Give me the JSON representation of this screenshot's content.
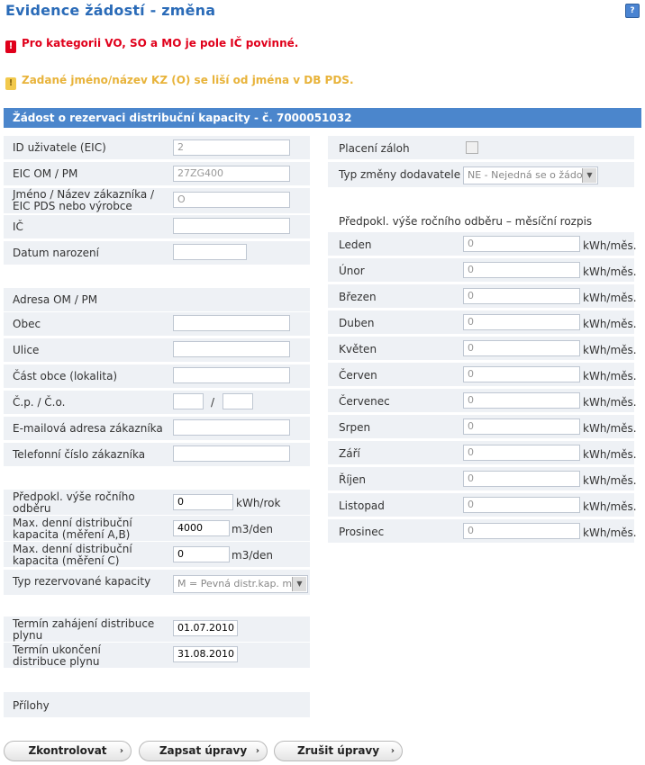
{
  "title": "Evidence žádostí - změna",
  "messages": {
    "error": "Pro kategorii VO, SO a MO je pole IČ povinné.",
    "warning": "Zadané jméno/název KZ (O) se liší od jména v DB PDS."
  },
  "section_title": "Žádost o rezervaci distribuční kapacity - č. 7000051032",
  "left": {
    "eic_label": "ID uživatele (EIC)",
    "eic_value": "2",
    "eicom_label": "EIC OM / PM",
    "eicom_value": "27ZG400",
    "name_label": "Jméno / Název zákazníka / EIC PDS nebo výrobce",
    "name_value": "O",
    "ic_label": "IČ",
    "ic_value": "",
    "birth_label": "Datum narození",
    "birth_value": "",
    "address_label": "Adresa OM / PM",
    "obec_label": "Obec",
    "obec_value": "",
    "ulice_label": "Ulice",
    "ulice_value": "",
    "cast_label": "Část obce (lokalita)",
    "cast_value": "",
    "cp_label": "Č.p. / Č.o.",
    "cp_value": "",
    "co_value": "",
    "cp_sep": "/",
    "email_label": "E-mailová adresa zákazníka",
    "email_value": "",
    "phone_label": "Telefonní číslo zákazníka",
    "phone_value": "",
    "annual_label": "Předpokl. výše ročního odběru",
    "annual_value": "0",
    "annual_unit": "kWh/rok",
    "maxab_label": "Max. denní distribuční kapacita (měření A,B)",
    "maxab_value": "4000",
    "maxab_unit": "m3/den",
    "maxc_label": "Max. denní distribuční kapacita (měření C)",
    "maxc_value": "0",
    "maxc_unit": "m3/den",
    "captype_label": "Typ rezervované kapacity",
    "captype_value": "M = Pevná distr.kap. m",
    "start_label": "Termín zahájení distribuce plynu",
    "start_value": "01.07.2010",
    "end_label": "Termín ukončení distribuce plynu",
    "end_value": "31.08.2010",
    "attach_label": "Přílohy"
  },
  "right": {
    "deposit_label": "Placení záloh",
    "supplier_change_label": "Typ změny dodavatele",
    "supplier_change_value": "NE - Nejedná se o žádo",
    "monthly_header": "Předpokl. výše ročního odběru – měsíční rozpis",
    "unit": "kWh/měs.",
    "months": [
      {
        "label": "Leden",
        "value": "0"
      },
      {
        "label": "Únor",
        "value": "0"
      },
      {
        "label": "Březen",
        "value": "0"
      },
      {
        "label": "Duben",
        "value": "0"
      },
      {
        "label": "Květen",
        "value": "0"
      },
      {
        "label": "Červen",
        "value": "0"
      },
      {
        "label": "Červenec",
        "value": "0"
      },
      {
        "label": "Srpen",
        "value": "0"
      },
      {
        "label": "Září",
        "value": "0"
      },
      {
        "label": "Říjen",
        "value": "0"
      },
      {
        "label": "Listopad",
        "value": "0"
      },
      {
        "label": "Prosinec",
        "value": "0"
      }
    ]
  },
  "buttons": {
    "check": "Zkontrolovat",
    "save": "Zapsat úpravy",
    "cancel": "Zrušit úpravy"
  }
}
